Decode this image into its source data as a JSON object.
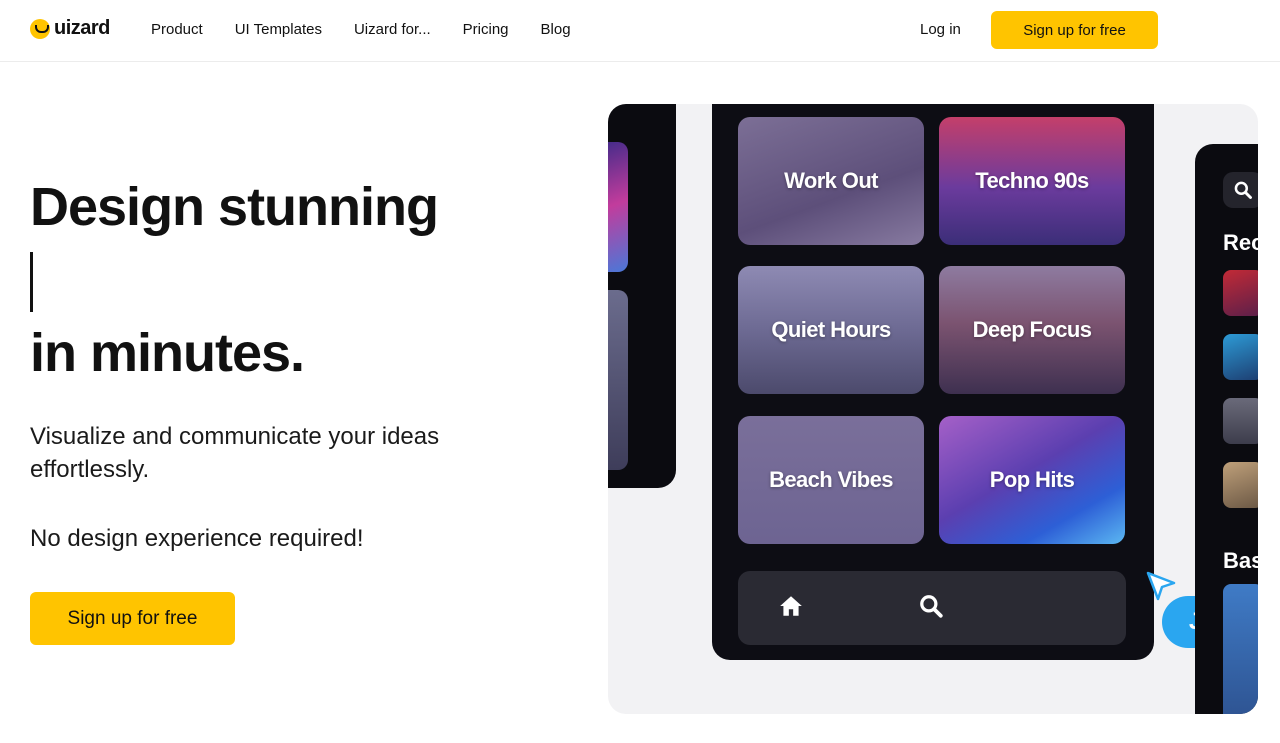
{
  "header": {
    "logo_text": "uizard",
    "nav": [
      "Product",
      "UI Templates",
      "Uizard for...",
      "Pricing",
      "Blog"
    ],
    "login_label": "Log in",
    "signup_label": "Sign up for free"
  },
  "hero": {
    "headline_line1": "Design stunning",
    "headline_line2": "in minutes.",
    "subtitle": "Visualize and communicate your ideas effortlessly.",
    "subtitle2": "No design experience required!",
    "cta_label": "Sign up for free"
  },
  "showcase": {
    "tiles": [
      "Work Out",
      "Techno 90s",
      "Quiet Hours",
      "Deep Focus",
      "Beach Vibes",
      "Pop Hits"
    ],
    "cursor_label": "Joe",
    "right_label1": "Rec",
    "right_label2": "Bas",
    "icons": [
      "home-icon",
      "search-icon",
      "cursor-icon"
    ]
  },
  "colors": {
    "accent": "#ffc400",
    "cursor_bubble": "#2aa6f0"
  }
}
